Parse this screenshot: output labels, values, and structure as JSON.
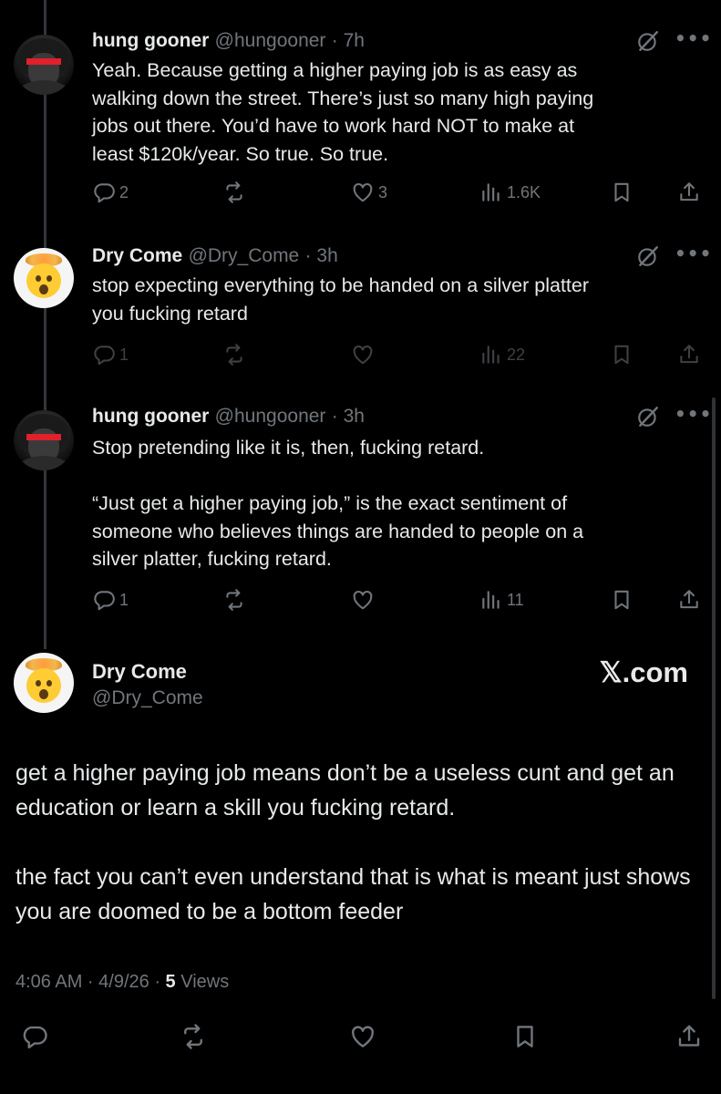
{
  "posts": [
    {
      "name": "hung gooner",
      "handle": "@hungooner",
      "time": "· 7h",
      "text": "Yeah. Because getting a higher paying job is as easy as\nwalking down the street. There’s just so many high paying\njobs out there. You’d have to work hard NOT to make at\nleast $120k/year. So true. So true.",
      "replies": "2",
      "reposts": "",
      "likes": "3",
      "views": "1.6K"
    },
    {
      "name": "Dry Come",
      "handle": "@Dry_Come",
      "time": "· 3h",
      "text": "stop expecting everything to be handed on a silver platter\nyou fucking retard",
      "replies": "1",
      "reposts": "",
      "likes": "",
      "views": "22"
    },
    {
      "name": "hung gooner",
      "handle": "@hungooner",
      "time": "· 3h",
      "text": "Stop pretending like it is, then, fucking retard.\n\n“Just get a higher paying job,” is the exact sentiment of\nsomeone who believes things are handed to people on a\nsilver platter, fucking retard.",
      "replies": "1",
      "reposts": "",
      "likes": "",
      "views": "11"
    }
  ],
  "main": {
    "name": "Dry Come",
    "handle": "@Dry_Come",
    "watermark": "𝕏.com",
    "paragraph1": "get a higher paying job means don’t be a useless cunt and get an education or learn a skill you fucking retard.",
    "paragraph2": "the fact you can’t even understand that is what is meant just shows you are doomed to be a bottom feeder",
    "timestamp": "4:06 AM · 4/9/26 · ",
    "views_count": "5",
    "views_label": " Views"
  },
  "more_label": "•••",
  "icons": [
    "reply-icon",
    "repost-icon",
    "like-icon",
    "views-icon",
    "bookmark-icon",
    "share-icon",
    "grok-icon",
    "more-icon"
  ]
}
